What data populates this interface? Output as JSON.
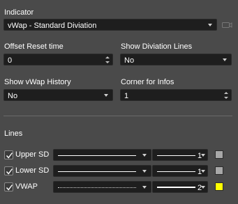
{
  "indicator": {
    "label": "Indicator",
    "selected": "vWap - Standard Diviation"
  },
  "offset_reset": {
    "label": "Offset Reset time",
    "value": "0"
  },
  "show_deviation_lines": {
    "label": "Show Diviation Lines",
    "selected": "No"
  },
  "show_history": {
    "label": "Show vWap History",
    "selected": "No"
  },
  "corner_infos": {
    "label": "Corner for Infos",
    "value": "1"
  },
  "lines": {
    "heading": "Lines",
    "rows": [
      {
        "name": "Upper SD",
        "checked": true,
        "style": "solid",
        "width": "1",
        "color": "#a8a8a8"
      },
      {
        "name": "Lower SD",
        "checked": true,
        "style": "solid",
        "width": "1",
        "color": "#a8a8a8"
      },
      {
        "name": "VWAP",
        "checked": true,
        "style": "dotted",
        "width": "2",
        "color": "#ffff00"
      }
    ]
  },
  "colors": {
    "background": "#4a4a4a",
    "field_bg": "#1e1e1e",
    "text": "#ffffff"
  }
}
